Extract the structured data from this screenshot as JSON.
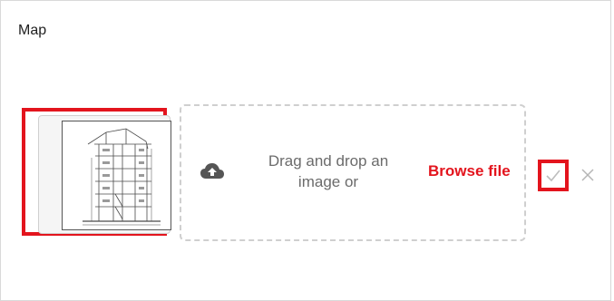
{
  "field": {
    "label": "Map"
  },
  "dropzone": {
    "prompt": "Drag and drop an image or",
    "browse_label": "Browse file",
    "icon": "cloud-upload-icon"
  },
  "actions": {
    "confirm_icon": "check-icon",
    "cancel_icon": "close-icon"
  },
  "colors": {
    "highlight": "#e3141d",
    "accent_text": "#e3141d",
    "muted_text": "#6b6b6b"
  }
}
